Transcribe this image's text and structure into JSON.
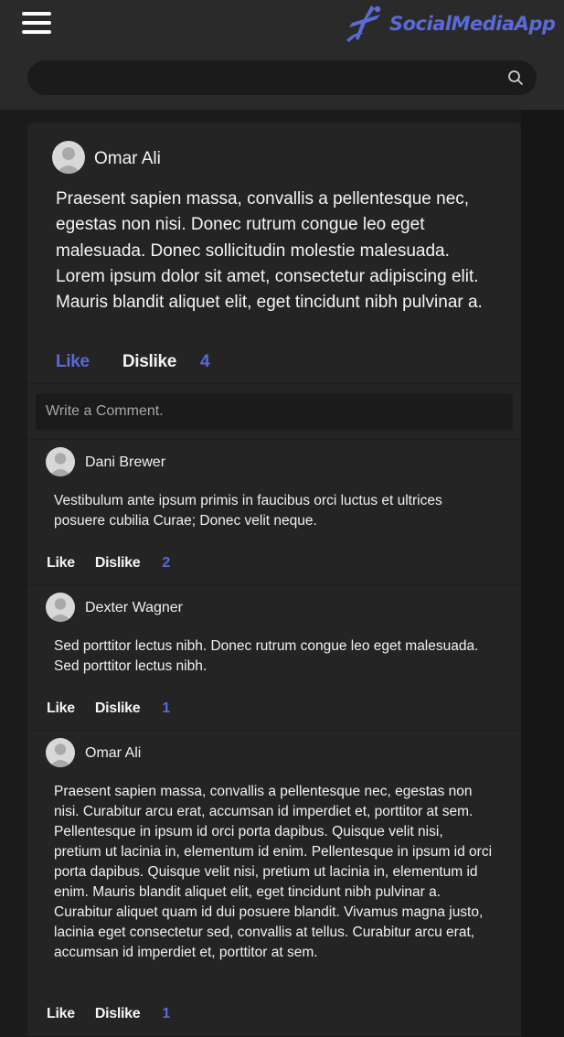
{
  "header": {
    "menu_icon": "hamburger-menu-icon",
    "logo_icon": "stylized-figure-logo-icon",
    "brand_name": "SocialMediaApp",
    "brand_color": "#5a6ad8"
  },
  "search": {
    "value": "",
    "placeholder": "",
    "icon": "search-icon"
  },
  "post": {
    "author": "Omar Ali",
    "body": "Praesent sapien massa, convallis a pellentesque nec, egestas non nisi. Donec rutrum congue leo eget malesuada. Donec sollicitudin molestie malesuada. Lorem ipsum dolor sit amet, consectetur adipiscing elit. Mauris blandit aliquet elit, eget tincidunt nibh pulvinar a.",
    "like_label": "Like",
    "dislike_label": "Dislike",
    "count": "4"
  },
  "comment_input": {
    "placeholder": "Write a Comment."
  },
  "comments": [
    {
      "author": "Dani Brewer",
      "body": "Vestibulum ante ipsum primis in faucibus orci luctus et ultrices posuere cubilia Curae; Donec velit neque.",
      "like_label": "Like",
      "dislike_label": "Dislike",
      "count": "2"
    },
    {
      "author": "Dexter Wagner",
      "body": "Sed porttitor lectus nibh. Donec rutrum congue leo eget malesuada. Sed porttitor lectus nibh.",
      "like_label": "Like",
      "dislike_label": "Dislike",
      "count": "1"
    },
    {
      "author": "Omar Ali",
      "body": "Praesent sapien massa, convallis a pellentesque nec, egestas non nisi. Curabitur arcu erat, accumsan id imperdiet et, porttitor at sem. Pellentesque in ipsum id orci porta dapibus. Quisque velit nisi, pretium ut lacinia in, elementum id enim. Pellentesque in ipsum id orci porta dapibus. Quisque velit nisi, pretium ut lacinia in, elementum id enim. Mauris blandit aliquet elit, eget tincidunt nibh pulvinar a. Curabitur aliquet quam id dui posuere blandit. Vivamus magna justo, lacinia eget consectetur sed, convallis at tellus. Curabitur arcu erat, accumsan id imperdiet et, porttitor at sem.",
      "like_label": "Like",
      "dislike_label": "Dislike",
      "count": "1"
    }
  ]
}
